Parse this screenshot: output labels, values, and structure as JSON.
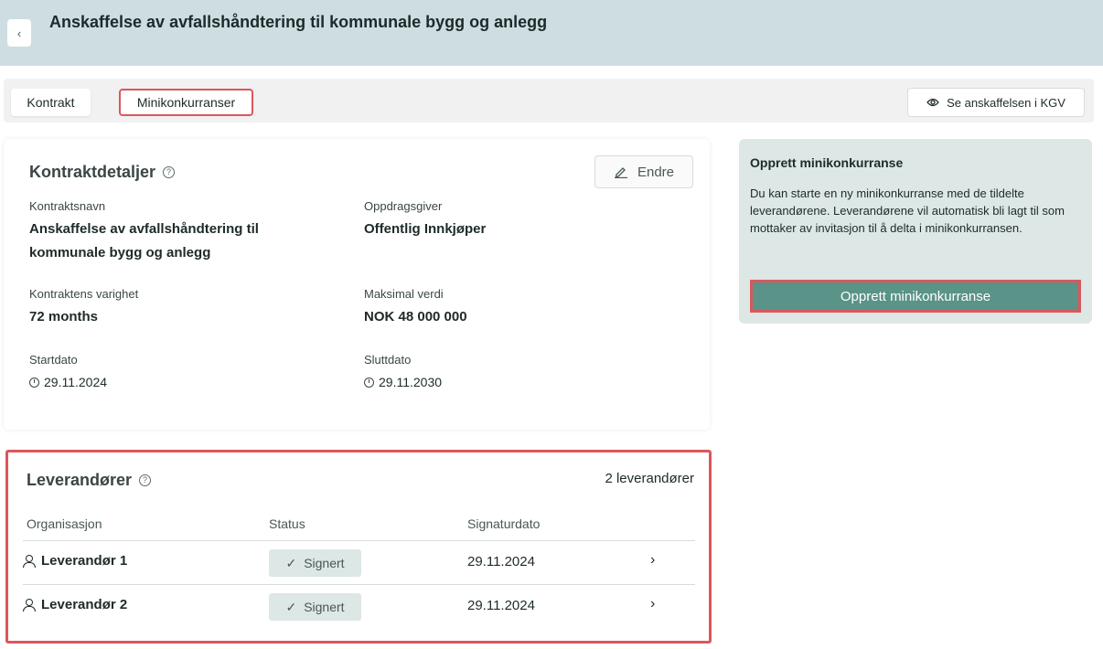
{
  "header": {
    "back_icon": "chevron-left-icon",
    "back_glyph": "‹",
    "title": "Anskaffelse av avfallshåndtering til kommunale bygg og anlegg"
  },
  "tabs": [
    {
      "label": "Kontrakt",
      "active": true
    },
    {
      "label": "Minikonkurranser",
      "highlighted": true
    }
  ],
  "kgv_button": {
    "label": "Se anskaffelsen i KGV",
    "icon": "eye-icon"
  },
  "contract_details": {
    "title": "Kontraktdetaljer",
    "help_glyph": "?",
    "edit_label": "Endre",
    "fields": {
      "name_label": "Kontraktsnavn",
      "name_value": "Anskaffelse av avfallshåndtering til kommunale bygg og anlegg",
      "client_label": "Oppdragsgiver",
      "client_value": "Offentlig Innkjøper",
      "duration_label": "Kontraktens varighet",
      "duration_value": "72 months",
      "max_label": "Maksimal verdi",
      "max_value": "NOK 48 000 000",
      "start_label": "Startdato",
      "start_value": "29.11.2024",
      "end_label": "Sluttdato",
      "end_value": "29.11.2030"
    }
  },
  "create_panel": {
    "title": "Opprett minikonkurranse",
    "text": "Du kan starte en ny minikonkurranse med de tildelte leverandørene. Leverandørene vil automatisk bli lagt til som mottaker av invitasjon til å delta i minikonkurransen.",
    "button_label": "Opprett minikonkurranse",
    "button_color": "#5a9387"
  },
  "suppliers": {
    "title": "Leverandører",
    "help_glyph": "?",
    "count_label": "2 leverandører",
    "columns": [
      "Organisasjon",
      "Status",
      "Signaturdato"
    ],
    "rows": [
      {
        "org": "Leverandør 1",
        "status": "Signert",
        "date": "29.11.2024"
      },
      {
        "org": "Leverandør 2",
        "status": "Signert",
        "date": "29.11.2024"
      }
    ],
    "check_glyph": "✓",
    "chevron_glyph": "›"
  },
  "colors": {
    "header_bg": "#cddde1",
    "highlight_border": "#d9585c",
    "badge_bg": "#dde7e6"
  }
}
